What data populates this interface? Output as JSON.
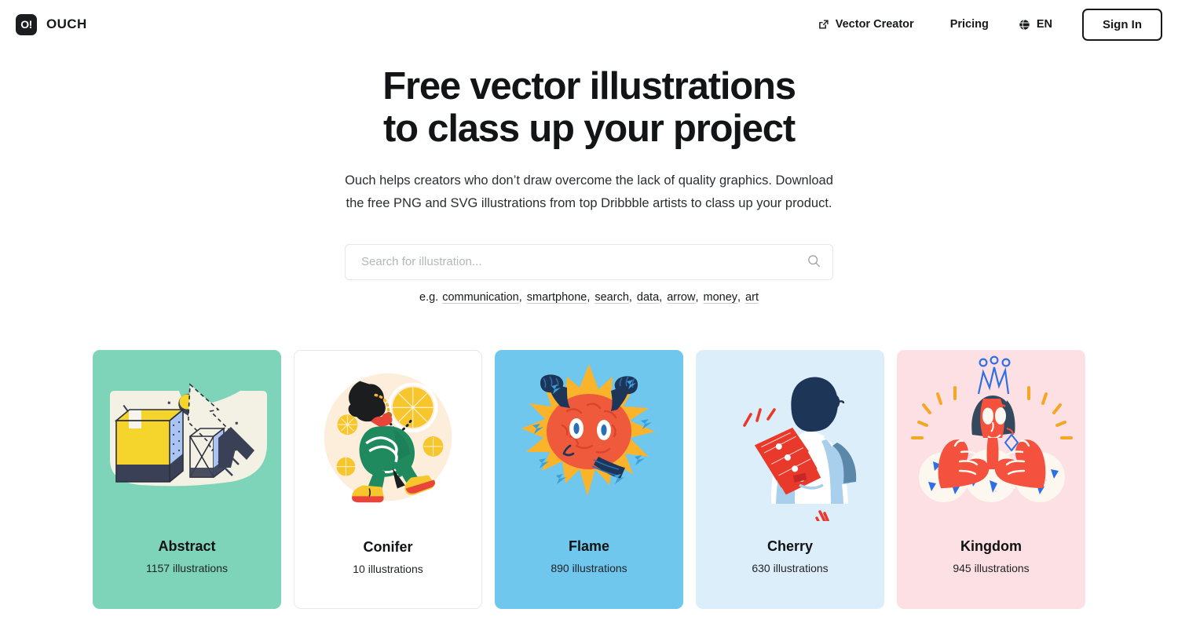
{
  "header": {
    "logo_text": "O!",
    "brand_name": "OUCH",
    "nav": [
      {
        "label": "Vector Creator",
        "icon": "external-link-icon"
      },
      {
        "label": "Pricing",
        "icon": ""
      }
    ],
    "language": {
      "label": "EN",
      "icon": "globe-icon"
    },
    "sign_in_label": "Sign In"
  },
  "hero": {
    "title_line1": "Free vector illustrations",
    "title_line2": "to class up your project",
    "subtitle": "Ouch helps creators who don’t draw overcome the lack of quality graphics. Download the free PNG and SVG illustrations from top Dribbble artists to class up your product."
  },
  "search": {
    "placeholder": "Search for illustration...",
    "value": "",
    "icon": "search-icon",
    "suggestions_prefix": "e.g.",
    "suggestions": [
      "communication",
      "smartphone",
      "search",
      "data",
      "arrow",
      "money",
      "art"
    ]
  },
  "cards": [
    {
      "title": "Abstract",
      "count": "1157 illustrations",
      "bg": "#7ed4b8",
      "bordered": false
    },
    {
      "title": "Conifer",
      "count": "10 illustrations",
      "bg": "#ffffff",
      "bordered": true
    },
    {
      "title": "Flame",
      "count": "890 illustrations",
      "bg": "#6fc7ed",
      "bordered": false
    },
    {
      "title": "Cherry",
      "count": "630 illustrations",
      "bg": "#ddeefb",
      "bordered": false
    },
    {
      "title": "Kingdom",
      "count": "945 illustrations",
      "bg": "#fce0e3",
      "bordered": false
    }
  ],
  "colors": {
    "ink": "#17181a",
    "cream": "#f3f0e4",
    "yellow": "#f5d42c",
    "blue_panel": "#a9c3f2",
    "navy": "#3a4055",
    "orange": "#f05a3c",
    "flame_yellow": "#fcb42b",
    "red": "#f4523f",
    "crown_blue": "#2f6fe4",
    "slate": "#34495e"
  }
}
